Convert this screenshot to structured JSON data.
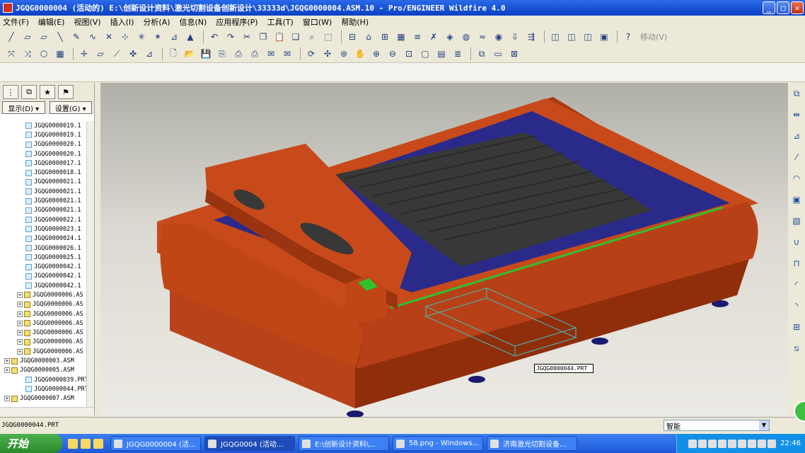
{
  "window": {
    "title": "JGQG0000004 (活动的) E:\\创新设计资料\\激光切割设备创新设计\\33333d\\JGQG0000004.ASM.10 - Pro/ENGINEER Wildfire 4.0",
    "min_label": "_",
    "max_label": "□",
    "close_label": "✕"
  },
  "menu": [
    "文件(F)",
    "编辑(E)",
    "视图(V)",
    "插入(I)",
    "分析(A)",
    "信息(N)",
    "应用程序(P)",
    "工具(T)",
    "窗口(W)",
    "帮助(H)"
  ],
  "toolbar": {
    "move_label": "移动(V)"
  },
  "panel": {
    "show_button": "显示(D) ▾",
    "settings_button": "设置(G) ▾",
    "tree_items": [
      {
        "label": "JGQG0000019.1",
        "type": "part",
        "expand": ""
      },
      {
        "label": "JGQG0000019.1",
        "type": "part",
        "expand": ""
      },
      {
        "label": "JGQG0000020.1",
        "type": "part",
        "expand": ""
      },
      {
        "label": "JGQG0000020.1",
        "type": "part",
        "expand": ""
      },
      {
        "label": "JGQG0000017.1",
        "type": "part",
        "expand": ""
      },
      {
        "label": "JGQG0000018.1",
        "type": "part",
        "expand": ""
      },
      {
        "label": "JGQG0000021.1",
        "type": "part",
        "expand": ""
      },
      {
        "label": "JGQG0000021.1",
        "type": "part",
        "expand": ""
      },
      {
        "label": "JGQG0000021.1",
        "type": "part",
        "expand": ""
      },
      {
        "label": "JGQG0000021.1",
        "type": "part",
        "expand": ""
      },
      {
        "label": "JGQG0000022.1",
        "type": "part",
        "expand": ""
      },
      {
        "label": "JGQG0000023.1",
        "type": "part",
        "expand": ""
      },
      {
        "label": "JGQG0000024.1",
        "type": "part",
        "expand": ""
      },
      {
        "label": "JGQG0000026.1",
        "type": "part",
        "expand": ""
      },
      {
        "label": "JGQG0000025.1",
        "type": "part",
        "expand": ""
      },
      {
        "label": "JGQG0000042.1",
        "type": "part",
        "expand": ""
      },
      {
        "label": "JGQG0000042.1",
        "type": "part",
        "expand": ""
      },
      {
        "label": "JGQG0000042.1",
        "type": "part",
        "expand": ""
      },
      {
        "label": "JGQG0000006.AS",
        "type": "asm",
        "expand": "+"
      },
      {
        "label": "JGQG0000006.AS",
        "type": "asm",
        "expand": "+"
      },
      {
        "label": "JGQG0000006.AS",
        "type": "asm",
        "expand": "+"
      },
      {
        "label": "JGQG0000006.AS",
        "type": "asm",
        "expand": "+"
      },
      {
        "label": "JGQG0000006.AS",
        "type": "asm",
        "expand": "+"
      },
      {
        "label": "JGQG0000006.AS",
        "type": "asm",
        "expand": "+"
      },
      {
        "label": "JGQG0000006.AS",
        "type": "asm",
        "expand": "+"
      },
      {
        "label": "JGQG0000003.ASM",
        "type": "asm",
        "expand": "+"
      },
      {
        "label": "JGQG0000005.ASM",
        "type": "asm",
        "expand": "+"
      },
      {
        "label": "JGQG0000039.PRT",
        "type": "part",
        "expand": ""
      },
      {
        "label": "JGQG0000044.PRT",
        "type": "part",
        "expand": ""
      },
      {
        "label": "JGQG0000007.ASM",
        "type": "asm",
        "expand": "+"
      }
    ]
  },
  "viewport": {
    "tooltip": "JGQG0000044.PRT"
  },
  "status": {
    "message": "JGQG0000044.PRT",
    "filter_value": "智能"
  },
  "taskbar": {
    "start_label": "开始",
    "tasks": [
      "JGQG0000004 (活...",
      "JGQG0004 (活动...",
      "E:\\创新设计资料\\...",
      "58.png - Windows...",
      "济南激光切割设备..."
    ],
    "clock": "22:46"
  },
  "colors": {
    "body": "#c84a1a",
    "bed": "#2a2a8a",
    "grid": "#383838",
    "green": "#30c030"
  }
}
